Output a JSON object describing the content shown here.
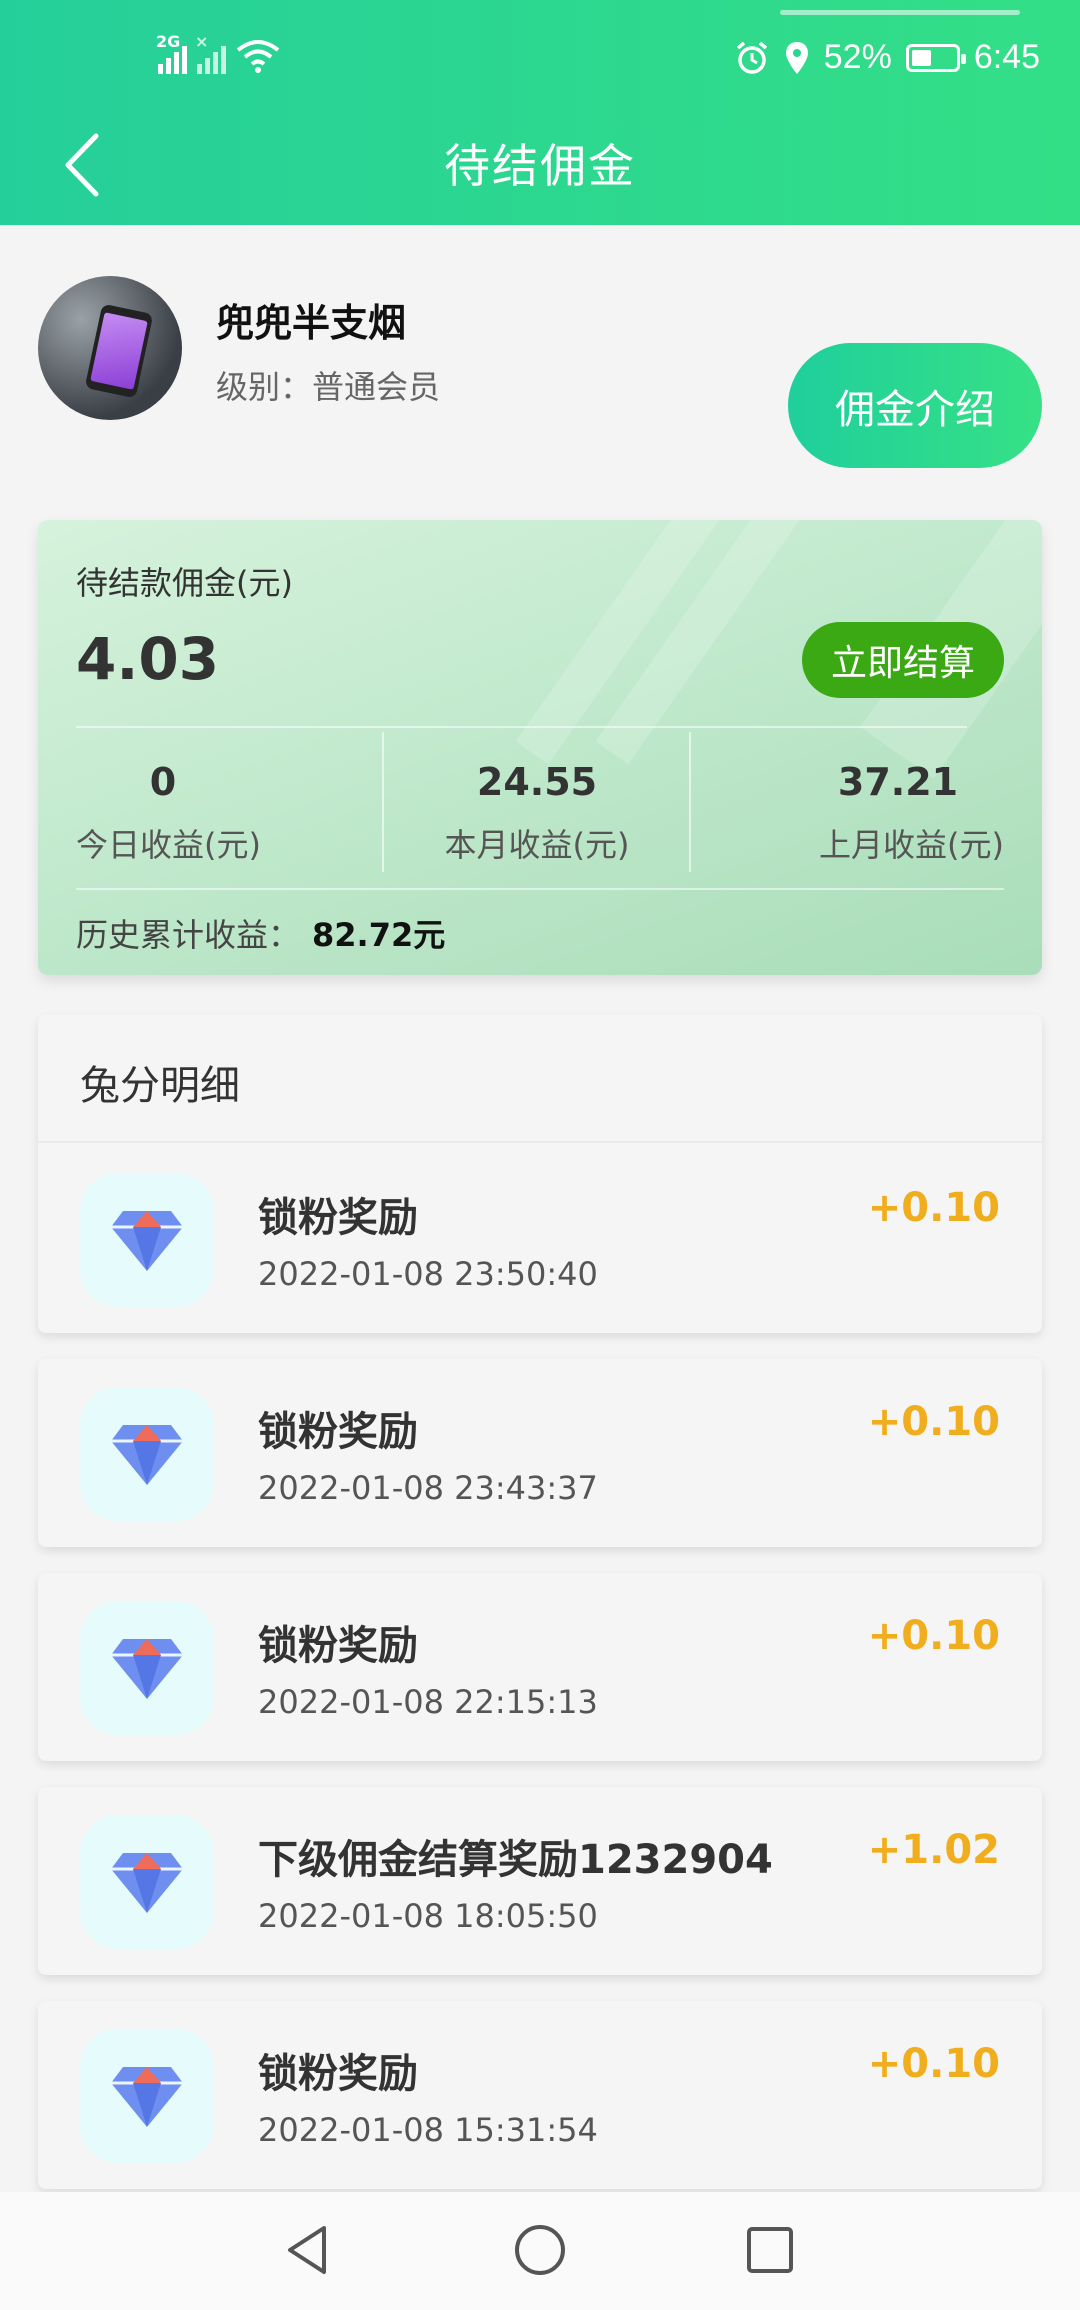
{
  "status_bar": {
    "network_label": "2G",
    "battery_percent": "52%",
    "battery_level": 0.52,
    "time": "6:45",
    "icons": [
      "signal-icon",
      "signal-off-icon",
      "wifi-icon",
      "alarm-icon",
      "location-icon",
      "battery-icon"
    ]
  },
  "header": {
    "title": "待结佣金",
    "back_icon": "chevron-left-icon"
  },
  "profile": {
    "name": "兜兜半支烟",
    "level": "级别：普通会员",
    "intro_button": "佣金介绍"
  },
  "summary": {
    "pending_label": "待结款佣金(元)",
    "pending_value": "4.03",
    "settle_button": "立即结算",
    "stats": [
      {
        "value": "0",
        "label": "今日收益(元)"
      },
      {
        "value": "24.55",
        "label": "本月收益(元)"
      },
      {
        "value": "37.21",
        "label": "上月收益(元)"
      }
    ],
    "history_label": "历史累计收益：",
    "history_value": "82.72元"
  },
  "detail": {
    "title": "兔分明细",
    "items": [
      {
        "title": "锁粉奖励",
        "time": "2022-01-08 23:50:40",
        "amount": "+0.10",
        "icon": "diamond-icon"
      },
      {
        "title": "锁粉奖励",
        "time": "2022-01-08 23:43:37",
        "amount": "+0.10",
        "icon": "diamond-icon"
      },
      {
        "title": "锁粉奖励",
        "time": "2022-01-08 22:15:13",
        "amount": "+0.10",
        "icon": "diamond-icon"
      },
      {
        "title": "下级佣金结算奖励1232904",
        "time": "2022-01-08 18:05:50",
        "amount": "+1.02",
        "icon": "diamond-icon"
      },
      {
        "title": "锁粉奖励",
        "time": "2022-01-08 15:31:54",
        "amount": "+0.10",
        "icon": "diamond-icon"
      }
    ]
  },
  "colors": {
    "header_start": "#25cf9a",
    "header_end": "#33df86",
    "settle": "#3aa913",
    "amount": "#f0ad1e"
  }
}
